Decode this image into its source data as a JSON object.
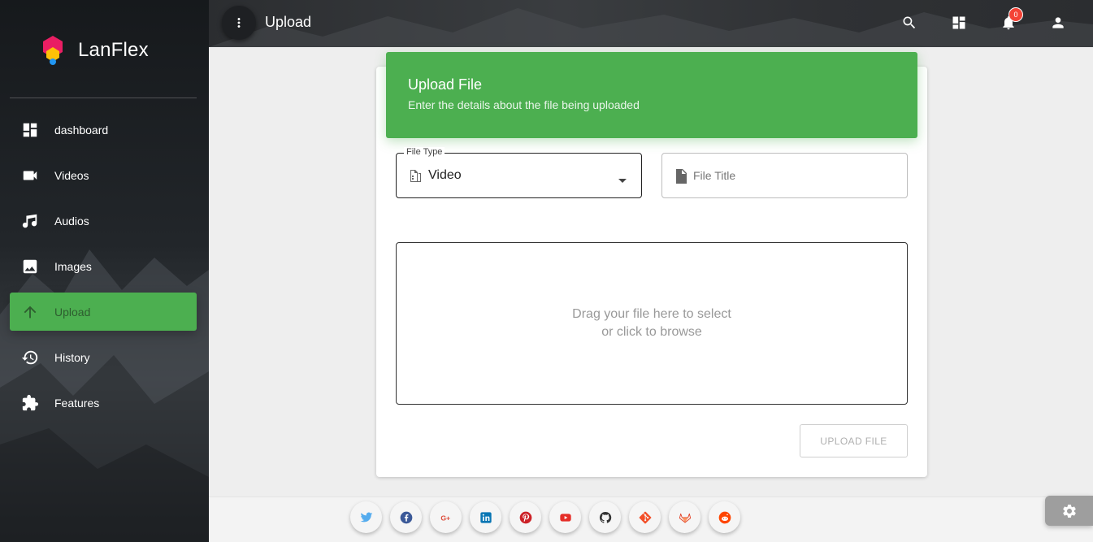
{
  "app": {
    "name": "LanFlex"
  },
  "colors": {
    "accent": "#4caf50",
    "badge": "#f44336",
    "sidebar_bg": "#1c1f22"
  },
  "sidebar": {
    "items": [
      {
        "label": "dashboard",
        "icon": "dashboard-icon",
        "active": false
      },
      {
        "label": "Videos",
        "icon": "videocam-icon",
        "active": false
      },
      {
        "label": "Audios",
        "icon": "music-note-icon",
        "active": false
      },
      {
        "label": "Images",
        "icon": "image-icon",
        "active": false
      },
      {
        "label": "Upload",
        "icon": "arrow-upward-icon",
        "active": true
      },
      {
        "label": "History",
        "icon": "history-icon",
        "active": false
      },
      {
        "label": "Features",
        "icon": "puzzle-icon",
        "active": false
      }
    ]
  },
  "topbar": {
    "title": "Upload",
    "menu_icon": "more-vert-icon",
    "actions": [
      "search-icon",
      "dashboard-icon",
      "notifications-icon",
      "person-icon"
    ],
    "notification_count": "0"
  },
  "upload_card": {
    "title": "Upload File",
    "subtitle": "Enter the details about the file being uploaded",
    "file_type": {
      "legend": "File Type",
      "value": "Video",
      "icon": "file-type-icon"
    },
    "file_title": {
      "placeholder": "File Title",
      "value": "",
      "icon": "file-icon"
    },
    "dropzone": {
      "line1": "Drag your file here to select",
      "line2": "or click to browse"
    },
    "submit_label": "UPLOAD FILE"
  },
  "footer": {
    "social": [
      {
        "name": "twitter-icon",
        "color": "#55acee"
      },
      {
        "name": "facebook-icon",
        "color": "#3b5998"
      },
      {
        "name": "google-plus-icon",
        "color": "#dd4b39"
      },
      {
        "name": "linkedin-icon",
        "color": "#0976b4"
      },
      {
        "name": "pinterest-icon",
        "color": "#cc2127"
      },
      {
        "name": "youtube-icon",
        "color": "#e52d27"
      },
      {
        "name": "github-icon",
        "color": "#333333"
      },
      {
        "name": "git-icon",
        "color": "#f34f29"
      },
      {
        "name": "gitlab-icon",
        "color": "#e24329"
      },
      {
        "name": "reddit-icon",
        "color": "#ff4500"
      }
    ],
    "settings_icon": "gear-icon"
  }
}
